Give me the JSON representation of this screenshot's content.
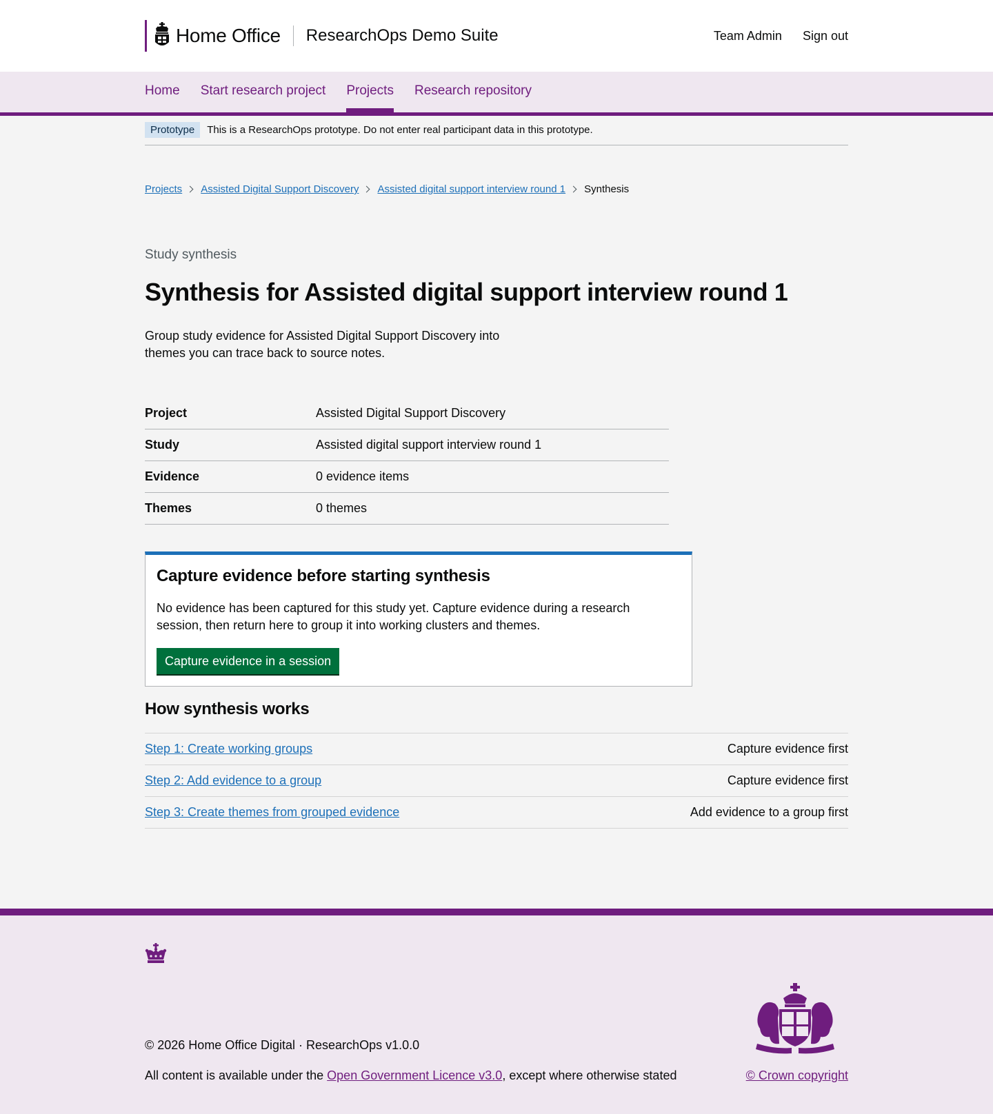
{
  "header": {
    "org_name": "Home Office",
    "service_name": "ResearchOps Demo Suite",
    "user_link": "Team Admin",
    "sign_out": "Sign out"
  },
  "nav": {
    "items": [
      {
        "label": "Home",
        "active": false
      },
      {
        "label": "Start research project",
        "active": false
      },
      {
        "label": "Projects",
        "active": true
      },
      {
        "label": "Research repository",
        "active": false
      }
    ]
  },
  "phase_banner": {
    "tag": "Prototype",
    "text": "This is a ResearchOps prototype. Do not enter real participant data in this prototype."
  },
  "breadcrumbs": [
    "Projects",
    "Assisted Digital Support Discovery",
    "Assisted digital support interview round 1",
    "Synthesis"
  ],
  "page": {
    "caption": "Study synthesis",
    "title": "Synthesis for Assisted digital support interview round 1",
    "lead": "Group study evidence for Assisted Digital Support Discovery into themes you can trace back to source notes."
  },
  "summary": [
    {
      "key": "Project",
      "value": "Assisted Digital Support Discovery"
    },
    {
      "key": "Study",
      "value": "Assisted digital support interview round 1"
    },
    {
      "key": "Evidence",
      "value": "0 evidence items"
    },
    {
      "key": "Themes",
      "value": "0 themes"
    }
  ],
  "card": {
    "title": "Capture evidence before starting synthesis",
    "body": "No evidence has been captured for this study yet. Capture evidence during a research session, then return here to group it into working clusters and themes.",
    "button": "Capture evidence in a session"
  },
  "how_it_works": {
    "title": "How synthesis works",
    "steps": [
      {
        "label": "Step 1: Create working groups",
        "status": "Capture evidence first"
      },
      {
        "label": "Step 2: Add evidence to a group",
        "status": "Capture evidence first"
      },
      {
        "label": "Step 3: Create themes from grouped evidence",
        "status": "Add evidence to a group first"
      }
    ]
  },
  "footer": {
    "meta": "© 2026 Home Office Digital · ResearchOps v1.0.0",
    "licence_prefix": "All content is available under the ",
    "licence_link": "Open Government Licence v3.0",
    "licence_suffix": ", except where otherwise stated",
    "copyright": "© Crown copyright",
    "crown_icon": "crown-icon",
    "crest_icon": "royal-coat-of-arms-icon"
  },
  "colors": {
    "brand_purple": "#6f1d7e",
    "link_blue": "#1d70b8",
    "button_green": "#00703c",
    "page_background": "#f4f4f4"
  }
}
